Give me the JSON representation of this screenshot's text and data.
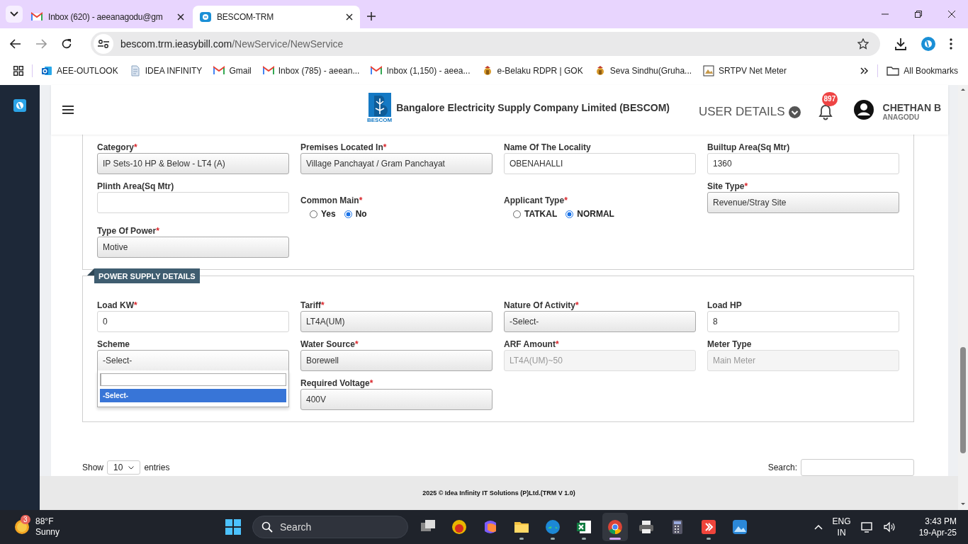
{
  "browser": {
    "tabs": [
      {
        "title": "Inbox (620) - aeeanagodu@gm",
        "kind": "mail",
        "selected": false
      },
      {
        "title": "BESCOM-TRM",
        "kind": "site",
        "selected": true
      }
    ],
    "address": {
      "host": "bescom.trm.ieasybill.com",
      "path": "/NewService/NewService"
    },
    "bookmarks": [
      {
        "label": "AEE-OUTLOOK",
        "kind": "outlook"
      },
      {
        "label": "IDEA INFINITY",
        "kind": "page"
      },
      {
        "label": "Gmail",
        "kind": "mail"
      },
      {
        "label": "Inbox (785) - aeean...",
        "kind": "mail"
      },
      {
        "label": "Inbox (1,150) - aeea...",
        "kind": "mail"
      },
      {
        "label": "e-Belaku RDPR | GOK",
        "kind": "emblem"
      },
      {
        "label": "Seva Sindhu(Gruha...",
        "kind": "emblem"
      },
      {
        "label": "SRTPV Net Meter",
        "kind": "photo"
      }
    ],
    "all_bookmarks": "All Bookmarks"
  },
  "app": {
    "header": {
      "logo_caption": "BESCOM",
      "title": "Bangalore Electricity Supply Company Limited (BESCOM)",
      "user_menu": "USER DETAILS",
      "notification_count": "897",
      "user_name": "CHETHAN B",
      "user_place": "ANAGODU"
    },
    "sections": [
      {
        "fields": [
          {
            "label": "Category",
            "required_mark": "*",
            "kind": "select",
            "value": "IP Sets-10 HP & Below - LT4 (A)"
          },
          {
            "label": "Premises Located In",
            "required_mark": "*",
            "kind": "select",
            "value": "Village Panchayat / Gram Panchayat"
          },
          {
            "label": "Name Of The Locality",
            "kind": "input",
            "value": "OBENAHALLI"
          },
          {
            "label": "Builtup Area(Sq Mtr)",
            "kind": "input",
            "value": "1360"
          },
          {
            "label": "Plinth Area(Sq Mtr)",
            "kind": "input"
          },
          {
            "label": "Common Main",
            "required_mark": "*",
            "kind": "radio",
            "options": [
              {
                "label": "Yes",
                "selected": false
              },
              {
                "label": "No",
                "selected": true
              }
            ]
          },
          {
            "label": "Applicant Type",
            "required_mark": "*",
            "kind": "radio",
            "options": [
              {
                "label": "TATKAL",
                "selected": false
              },
              {
                "label": "NORMAL",
                "selected": true
              }
            ]
          },
          {
            "label": "Site Type",
            "required_mark": "*",
            "kind": "select",
            "value": "Revenue/Stray Site"
          },
          {
            "label": "Type Of Power",
            "required_mark": "*",
            "kind": "select",
            "value": "Motive"
          }
        ]
      },
      {
        "title": "POWER SUPPLY DETAILS",
        "fields": [
          {
            "label": "Load KW",
            "required_mark": "*",
            "kind": "input",
            "value": "0"
          },
          {
            "label": "Tariff",
            "required_mark": "*",
            "kind": "select",
            "value": "LT4A(UM)"
          },
          {
            "label": "Nature Of Activity",
            "required_mark": "*",
            "kind": "select",
            "value": "-Select-"
          },
          {
            "label": "Load HP",
            "kind": "input",
            "value": "8"
          },
          {
            "label": "Scheme",
            "kind": "select",
            "value": "-Select-",
            "open": true,
            "options": [
              {
                "label": "-Select-",
                "selected": true
              }
            ]
          },
          {
            "label": "Water Source",
            "required_mark": "*",
            "kind": "select",
            "value": "Borewell"
          },
          {
            "label": "ARF Amount",
            "required_mark": "*",
            "kind": "disabled",
            "value": "LT4A(UM)~50"
          },
          {
            "label": "Meter Type",
            "kind": "disabled",
            "value": "Main Meter"
          },
          {
            "label": "Required Voltage",
            "required_mark": "*",
            "kind": "select",
            "value": "400V"
          }
        ]
      }
    ],
    "table_controls": {
      "show": "Show",
      "page_size": "10",
      "entries": "entries",
      "search_label": "Search:"
    },
    "footer": "2025 © Idea Infinity IT Solutions (P)Ltd.(TRM V 1.0)"
  },
  "taskbar": {
    "weather": {
      "badge": "3",
      "temperature": "88°F",
      "condition": "Sunny"
    },
    "search_placeholder": "Search",
    "apps": [
      {
        "running": false,
        "selected": false
      },
      {
        "running": false,
        "selected": false
      },
      {
        "running": false,
        "selected": false
      },
      {
        "running": true,
        "selected": false
      },
      {
        "running": true,
        "selected": false
      },
      {
        "running": true,
        "selected": false
      },
      {
        "running": true,
        "selected": true
      },
      {
        "running": false,
        "selected": false
      },
      {
        "running": false,
        "selected": false
      },
      {
        "running": true,
        "selected": false
      },
      {
        "running": false,
        "selected": false
      }
    ],
    "language": "ENG",
    "region": "IN",
    "time": "3:43 PM",
    "date": "19-Apr-25"
  }
}
